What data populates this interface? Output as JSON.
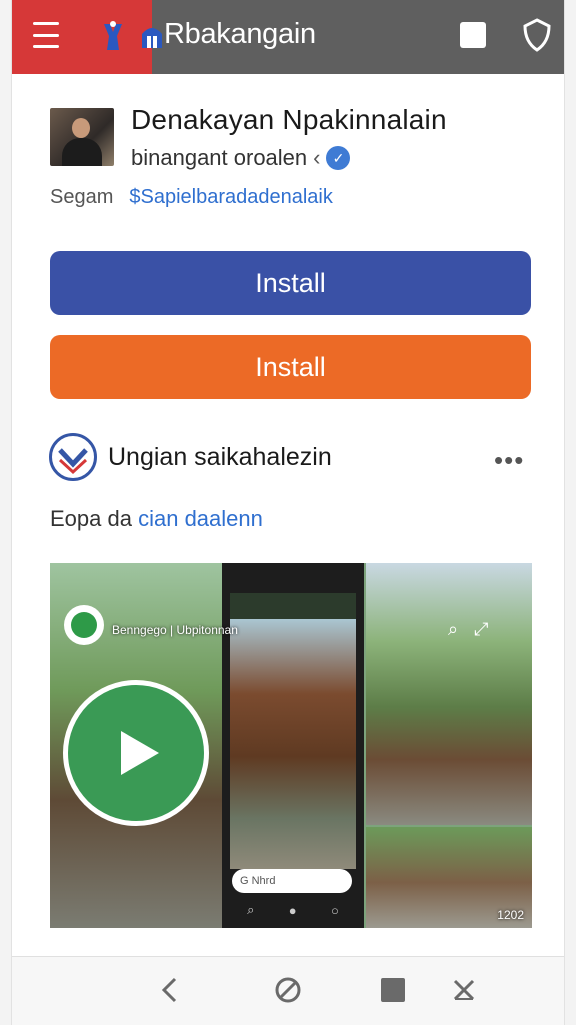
{
  "topbar": {
    "title": "Rbakangain",
    "menu_icon": "hamburger-icon",
    "square_icon": "square-icon",
    "shield_icon": "shield-icon"
  },
  "app": {
    "name": "Denakayan Npakinnalain",
    "developer": "binangant oroalen",
    "meta_label": "Segam",
    "meta_link": "$Sapielbaradadenalaik"
  },
  "buttons": {
    "primary": "Install",
    "secondary": "Install"
  },
  "section": {
    "title": "Ungian saikahalezin",
    "more": "•••",
    "subtitle_plain": "Eopa da",
    "subtitle_link": "cian daalenn"
  },
  "media": {
    "overlay_text": "Benngego | Ubpitonnan",
    "phone_search": "G Nhrd",
    "counter": "1202"
  },
  "colors": {
    "red": "#d63838",
    "topbar": "#5f5f5f",
    "blue": "#3a51a6",
    "orange": "#ec6a26",
    "green": "#3a9a55"
  },
  "bottom_nav": [
    "back-icon",
    "block-icon",
    "square-icon",
    "close-icon"
  ]
}
